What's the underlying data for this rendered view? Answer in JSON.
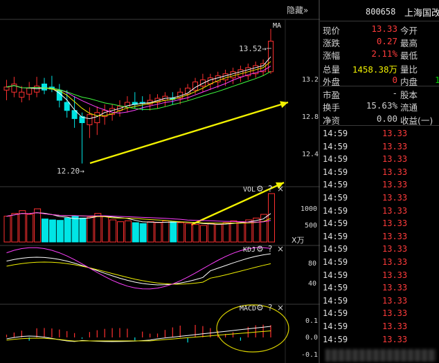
{
  "topbar": {
    "hide_label": "隐藏",
    "hide_arrows": "»"
  },
  "ma_label": "MA",
  "price_annotations": {
    "high": "13.52",
    "low": "12.20"
  },
  "price_axis": [
    "13.2",
    "12.8",
    "12.4"
  ],
  "panels": {
    "vol": {
      "label": "VOL",
      "axis": [
        "1000",
        "500"
      ],
      "unit": "X万"
    },
    "kdj": {
      "label": "KDJ",
      "axis": [
        "80",
        "40"
      ]
    },
    "macd": {
      "label": "MACD",
      "axis": [
        "0.1",
        "0.0",
        "-0.1"
      ]
    }
  },
  "icons": {
    "settings": "gear-icon",
    "help": "question-icon",
    "close": "close-icon"
  },
  "controls": {
    "help_glyph": "?",
    "close_glyph": "×"
  },
  "colors": {
    "up": "#ff3030",
    "down": "#00e5e5",
    "accent_arrow": "#f2f200",
    "ellipse": "#d8d000",
    "price_red": "#ff3b3b",
    "price_green": "#00d000"
  },
  "quote": {
    "code": "800658",
    "name": "上海国改",
    "rows": [
      {
        "k": "现价",
        "v": "13.33",
        "k2": "今开",
        "color": "#ff3b3b"
      },
      {
        "k": "涨跌",
        "v": "0.27",
        "k2": "最高",
        "color": "#ff3b3b"
      },
      {
        "k": "涨幅",
        "v": "2.11%",
        "k2": "最低",
        "color": "#ff3b3b"
      },
      {
        "k": "总量",
        "v": "1458.38万",
        "k2": "量比",
        "color": "#f0f000"
      },
      {
        "k": "外盘",
        "v": "0",
        "k2": "内盘",
        "v2": "1",
        "color": "#ff3b3b"
      },
      {
        "k": "市盈",
        "v": "-",
        "k2": "股本",
        "color": "#d0d0d0"
      },
      {
        "k": "换手",
        "v": "15.63%",
        "k2": "流通",
        "color": "#d0d0d0"
      },
      {
        "k": "净资",
        "v": "0.00",
        "k2": "收益(一)",
        "color": "#d0d0d0"
      }
    ],
    "ticks": [
      {
        "time": "14:59",
        "price": "13.33"
      },
      {
        "time": "14:59",
        "price": "13.33"
      },
      {
        "time": "14:59",
        "price": "13.33"
      },
      {
        "time": "14:59",
        "price": "13.33"
      },
      {
        "time": "14:59",
        "price": "13.33"
      },
      {
        "time": "14:59",
        "price": "13.33"
      },
      {
        "time": "14:59",
        "price": "13.33"
      },
      {
        "time": "14:59",
        "price": "13.33"
      },
      {
        "time": "14:59",
        "price": "13.33"
      },
      {
        "time": "14:59",
        "price": "13.33"
      },
      {
        "time": "14:59",
        "price": "13.33"
      },
      {
        "time": "14:59",
        "price": "13.33"
      },
      {
        "time": "14:59",
        "price": "13.33"
      },
      {
        "time": "14:59",
        "price": "13.33"
      },
      {
        "time": "14:59",
        "price": "13.33"
      },
      {
        "time": "14:59",
        "price": "13.33"
      },
      {
        "time": "14:59",
        "price": "13.33"
      }
    ]
  },
  "chart_data": {
    "type": "candlestick",
    "candles": [
      {
        "o": 12.92,
        "h": 13.02,
        "l": 12.82,
        "c": 12.95,
        "up": true
      },
      {
        "o": 12.9,
        "h": 13.05,
        "l": 12.85,
        "c": 12.98,
        "up": true
      },
      {
        "o": 12.85,
        "h": 12.96,
        "l": 12.8,
        "c": 12.9,
        "up": true
      },
      {
        "o": 12.88,
        "h": 13.0,
        "l": 12.82,
        "c": 12.94,
        "up": true
      },
      {
        "o": 12.9,
        "h": 13.05,
        "l": 12.85,
        "c": 12.96,
        "up": true
      },
      {
        "o": 12.98,
        "h": 13.04,
        "l": 12.88,
        "c": 12.92,
        "up": false
      },
      {
        "o": 12.95,
        "h": 13.06,
        "l": 12.9,
        "c": 12.93,
        "up": false
      },
      {
        "o": 12.92,
        "h": 12.98,
        "l": 12.75,
        "c": 12.82,
        "up": false
      },
      {
        "o": 12.8,
        "h": 12.92,
        "l": 12.65,
        "c": 12.72,
        "up": false
      },
      {
        "o": 12.72,
        "h": 12.86,
        "l": 12.55,
        "c": 12.64,
        "up": false
      },
      {
        "o": 12.66,
        "h": 12.7,
        "l": 12.2,
        "c": 12.6,
        "up": false
      },
      {
        "o": 12.58,
        "h": 12.75,
        "l": 12.45,
        "c": 12.68,
        "up": true
      },
      {
        "o": 12.6,
        "h": 12.76,
        "l": 12.48,
        "c": 12.7,
        "up": true
      },
      {
        "o": 12.66,
        "h": 12.78,
        "l": 12.58,
        "c": 12.72,
        "up": true
      },
      {
        "o": 12.68,
        "h": 12.78,
        "l": 12.62,
        "c": 12.74,
        "up": true
      },
      {
        "o": 12.72,
        "h": 12.82,
        "l": 12.66,
        "c": 12.76,
        "up": true
      },
      {
        "o": 12.75,
        "h": 12.86,
        "l": 12.7,
        "c": 12.8,
        "up": true
      },
      {
        "o": 12.8,
        "h": 12.9,
        "l": 12.74,
        "c": 12.78,
        "up": false
      },
      {
        "o": 12.8,
        "h": 12.86,
        "l": 12.72,
        "c": 12.79,
        "up": false
      },
      {
        "o": 12.78,
        "h": 12.88,
        "l": 12.72,
        "c": 12.82,
        "up": true
      },
      {
        "o": 12.8,
        "h": 12.88,
        "l": 12.74,
        "c": 12.84,
        "up": true
      },
      {
        "o": 12.82,
        "h": 12.9,
        "l": 12.76,
        "c": 12.86,
        "up": true
      },
      {
        "o": 12.84,
        "h": 12.9,
        "l": 12.78,
        "c": 12.83,
        "up": false
      },
      {
        "o": 12.84,
        "h": 12.94,
        "l": 12.78,
        "c": 12.9,
        "up": true
      },
      {
        "o": 12.88,
        "h": 12.98,
        "l": 12.82,
        "c": 12.94,
        "up": true
      },
      {
        "o": 12.92,
        "h": 13.04,
        "l": 12.88,
        "c": 13.0,
        "up": true
      },
      {
        "o": 12.96,
        "h": 13.08,
        "l": 12.9,
        "c": 13.02,
        "up": true
      },
      {
        "o": 12.98,
        "h": 13.08,
        "l": 12.92,
        "c": 13.04,
        "up": true
      },
      {
        "o": 13.0,
        "h": 13.1,
        "l": 12.94,
        "c": 13.06,
        "up": true
      },
      {
        "o": 13.02,
        "h": 13.12,
        "l": 12.96,
        "c": 13.08,
        "up": true
      },
      {
        "o": 13.04,
        "h": 13.14,
        "l": 12.98,
        "c": 13.1,
        "up": true
      },
      {
        "o": 13.05,
        "h": 13.16,
        "l": 13.0,
        "c": 13.12,
        "up": true
      },
      {
        "o": 13.06,
        "h": 13.18,
        "l": 13.02,
        "c": 13.14,
        "up": true
      },
      {
        "o": 13.08,
        "h": 13.2,
        "l": 13.04,
        "c": 13.16,
        "up": true
      },
      {
        "o": 13.1,
        "h": 13.22,
        "l": 13.06,
        "c": 13.18,
        "up": true
      },
      {
        "o": 13.1,
        "h": 13.52,
        "l": 13.08,
        "c": 13.4,
        "up": true
      }
    ],
    "volume": [
      560,
      620,
      680,
      600,
      720,
      500,
      480,
      470,
      520,
      560,
      520,
      540,
      620,
      560,
      480,
      440,
      460,
      420,
      400,
      440,
      420,
      460,
      440,
      420,
      400,
      380,
      360,
      400,
      380,
      420,
      460,
      440,
      480,
      520,
      600,
      1050
    ],
    "volume_up": [
      true,
      true,
      true,
      true,
      true,
      false,
      false,
      false,
      false,
      false,
      false,
      true,
      true,
      true,
      true,
      true,
      true,
      false,
      false,
      true,
      true,
      true,
      false,
      true,
      true,
      true,
      true,
      true,
      true,
      true,
      true,
      true,
      true,
      true,
      true,
      true
    ],
    "ylim": [
      12.0,
      13.6
    ],
    "vol_ylim": [
      0,
      1200
    ]
  }
}
